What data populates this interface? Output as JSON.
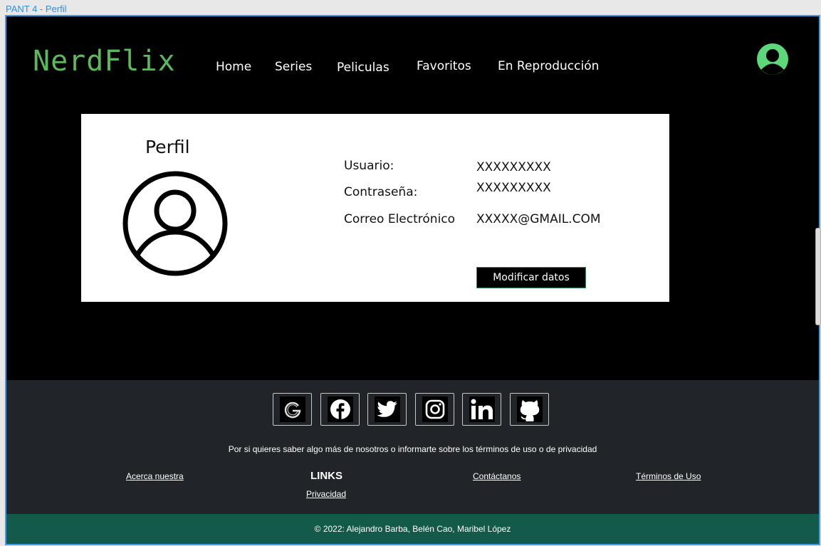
{
  "frame": {
    "title": "PANT 4 - Perfil"
  },
  "header": {
    "logo": "NerdFlix",
    "nav": [
      "Home",
      "Series",
      "Peliculas",
      "Favoritos",
      "En Reproducción"
    ]
  },
  "profile": {
    "title": "Perfil",
    "fields": [
      {
        "label": "Usuario:",
        "value": "XXXXXXXXX"
      },
      {
        "label": "Contraseña:",
        "value": "XXXXXXXXX"
      },
      {
        "label": "Correo Electrónico",
        "value": "XXXXX@GMAIL.COM"
      }
    ],
    "button": "Modificar datos"
  },
  "footer": {
    "social_icons": [
      "google-icon",
      "facebook-icon",
      "twitter-icon",
      "instagram-icon",
      "linkedin-icon",
      "github-icon"
    ],
    "info_text": "Por si quieres saber algo más de nosotros o informarte sobre los términos de uso o de privacidad",
    "links_heading": "LINKS",
    "links": {
      "about": "Acerca nuestra",
      "privacy": "Privacidad",
      "contact": "Contáctanos",
      "terms": "Términos de Uso"
    },
    "copyright": "© 2022: Alejandro Barba, Belén Cao, Maribel López"
  },
  "colors": {
    "logo": "#5cb85c",
    "footer_bg": "#212529",
    "copyright_bg": "#145a4a",
    "frame_border": "#3a9ee8"
  }
}
